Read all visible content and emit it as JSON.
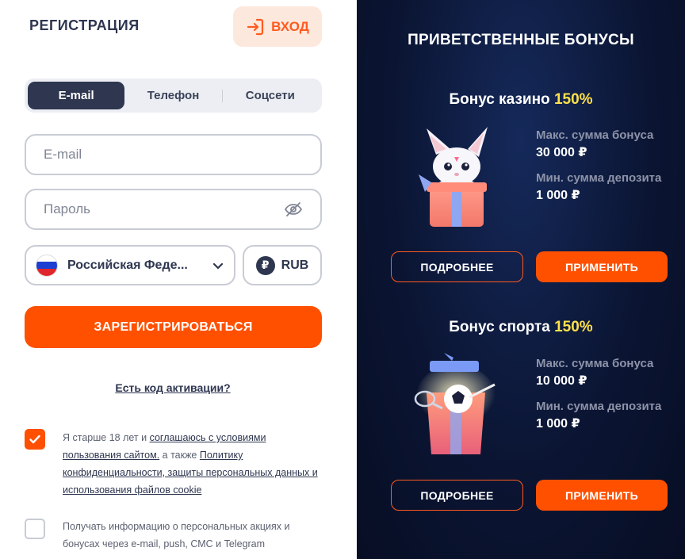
{
  "header": {
    "title": "РЕГИСТРАЦИЯ",
    "login_label": "ВХОД"
  },
  "tabs": [
    {
      "label": "E-mail",
      "active": true
    },
    {
      "label": "Телефон",
      "active": false
    },
    {
      "label": "Соцсети",
      "active": false
    }
  ],
  "form": {
    "email_placeholder": "E-mail",
    "password_placeholder": "Пароль",
    "country": "Российская Феде...",
    "currency_symbol": "₽",
    "currency": "RUB",
    "register_label": "ЗАРЕГИСТРИРОВАТЬСЯ",
    "promo_link": "Есть код активации?"
  },
  "consent": {
    "checked": true,
    "p1": "Я старше 18 лет и ",
    "link1": "соглашаюсь с условиями пользования сайтом.",
    "p2": " а также ",
    "link2": "Политику конфиденциальности, защиты персональных данных и использования файлов cookie"
  },
  "marketing": {
    "checked": false,
    "text": "Получать информацию о персональных акциях и бонусах через e-mail, push, СМС и Telegram"
  },
  "bonuses": {
    "title": "ПРИВЕТСТВЕННЫЕ БОНУСЫ",
    "casino": {
      "name": "Бонус казино",
      "percent": "150%",
      "max_label": "Макс. сумма бонуса",
      "max_value": "30 000 ₽",
      "min_label": "Мин. сумма депозита",
      "min_value": "1 000 ₽",
      "details_label": "ПОДРОБНЕЕ",
      "apply_label": "ПРИМЕНИТЬ"
    },
    "sport": {
      "name": "Бонус спорта",
      "percent": "150%",
      "max_label": "Макс. сумма бонуса",
      "max_value": "10 000 ₽",
      "min_label": "Мин. сумма депозита",
      "min_value": "1 000 ₽",
      "details_label": "ПОДРОБНЕЕ",
      "apply_label": "ПРИМЕНИТЬ"
    }
  },
  "colors": {
    "accent": "#ff5000",
    "dark": "#2e3650",
    "panel_bg": "#0b1533",
    "highlight": "#ffe14a"
  },
  "icons": {
    "login": "login-arrow-icon",
    "password_visibility": "eye-off-icon",
    "country_flag": "russia-flag-icon",
    "dropdown": "chevron-down-icon",
    "currency": "ruble-icon",
    "checkbox": "checkmark-icon"
  }
}
